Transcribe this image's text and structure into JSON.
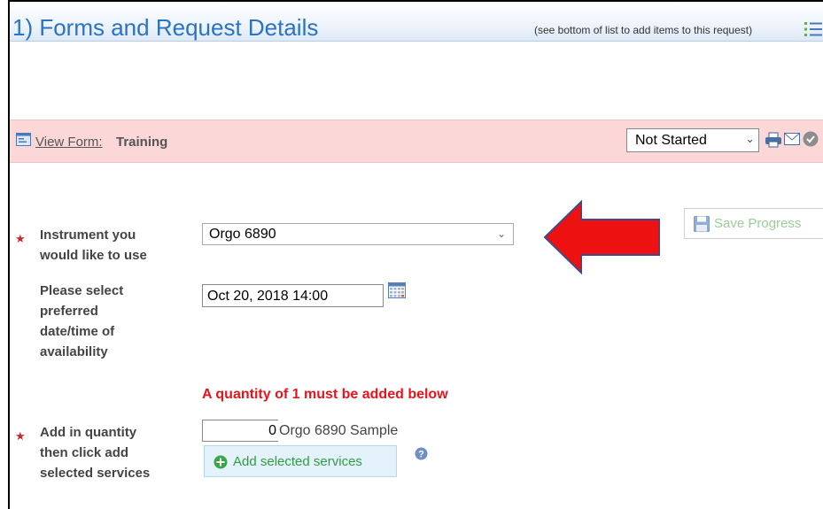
{
  "header": {
    "title": "1) Forms and Request Details",
    "note": "(see bottom of list to add items to this request)"
  },
  "form_bar": {
    "view_form_label": "View Form:",
    "form_name": "Training",
    "status_value": "Not Started"
  },
  "fields": {
    "instrument": {
      "label_lines": [
        "Instrument you",
        "would like to use"
      ],
      "value": "Orgo 6890",
      "required": true
    },
    "date": {
      "label_lines": [
        "Please select",
        "preferred",
        "date/time of",
        "availability"
      ],
      "value": "Oct 20, 2018 14:00"
    },
    "quantity": {
      "warning": "A quantity of 1 must be added below",
      "label_lines": [
        "Add in quantity",
        "then click add",
        "selected services"
      ],
      "value": "0",
      "service_name": "Orgo 6890 Sample",
      "required": true
    }
  },
  "buttons": {
    "add_services": "Add selected services",
    "save_progress": "Save Progress"
  },
  "icons": [
    "list-icon",
    "form-icon",
    "print-icon",
    "mail-icon",
    "check-icon",
    "calendar-icon",
    "add-icon",
    "help-icon",
    "save-icon",
    "arrow-graphic"
  ],
  "colors": {
    "title_blue": "#2a73c4",
    "form_bar_pink": "#fcd7d7",
    "warning_red": "#e8141b",
    "arrow_red": "#ee1111",
    "arrow_outline": "#3f4a8a",
    "add_green": "#2e9e3e",
    "save_green": "#9acd9a"
  }
}
